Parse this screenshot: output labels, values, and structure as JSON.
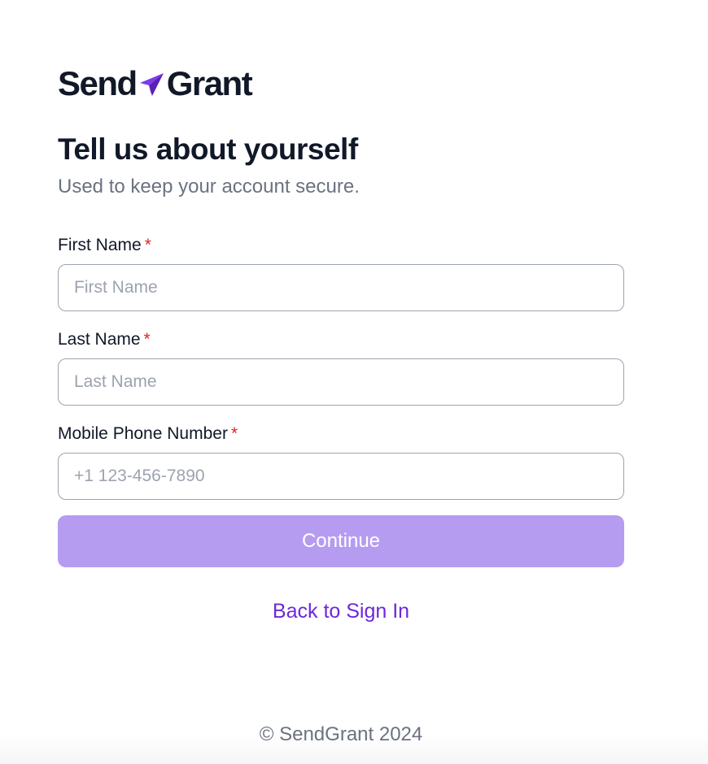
{
  "brand": {
    "name_part1": "Send",
    "name_part2": "Grant",
    "accent_color": "#7c3aed",
    "logo_icon": "paper-plane-icon"
  },
  "header": {
    "title": "Tell us about yourself",
    "subtitle": "Used to keep your account secure."
  },
  "form": {
    "first_name": {
      "label": "First Name",
      "required_marker": "*",
      "value": "",
      "placeholder": "First Name"
    },
    "last_name": {
      "label": "Last Name",
      "required_marker": "*",
      "value": "",
      "placeholder": "Last Name"
    },
    "phone": {
      "label": "Mobile Phone Number",
      "required_marker": "*",
      "value": "",
      "placeholder": "+1 123-456-7890"
    },
    "continue_label": "Continue",
    "continue_color": "#b69cf0"
  },
  "links": {
    "back_to_sign_in": "Back to Sign In"
  },
  "footer": {
    "copyright": "© SendGrant 2024"
  }
}
